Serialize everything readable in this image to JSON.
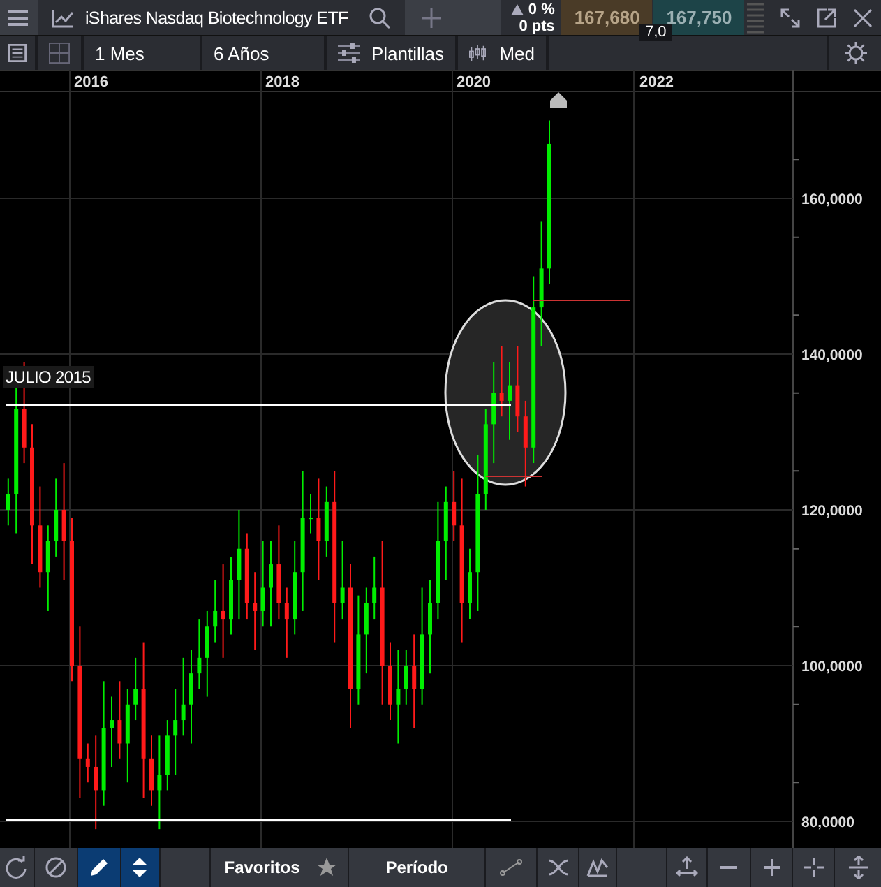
{
  "top_bar": {
    "title": "iShares Nasdaq Biotechnology ETF",
    "change_percent": "0 %",
    "change_points": "0 pts",
    "sell_price": "167,680",
    "buy_price": "167,750",
    "spread": "7,0"
  },
  "chart_toolbar": {
    "interval": "1 Mes",
    "range": "6 Años",
    "templates": "Plantillas",
    "price_type": "Med"
  },
  "chart": {
    "x_labels": [
      "2016",
      "2018",
      "2020",
      "2022"
    ],
    "y_labels": [
      "160,0000",
      "140,0000",
      "120,0000",
      "100,0000",
      "80,0000"
    ],
    "annotation": "JULIO 2015"
  },
  "bottom_bar": {
    "tools": [
      {
        "selected": false
      },
      {
        "selected": false
      },
      {
        "selected": true
      },
      {
        "selected": true
      }
    ],
    "favorites": "Favoritos",
    "period": "Período"
  }
}
